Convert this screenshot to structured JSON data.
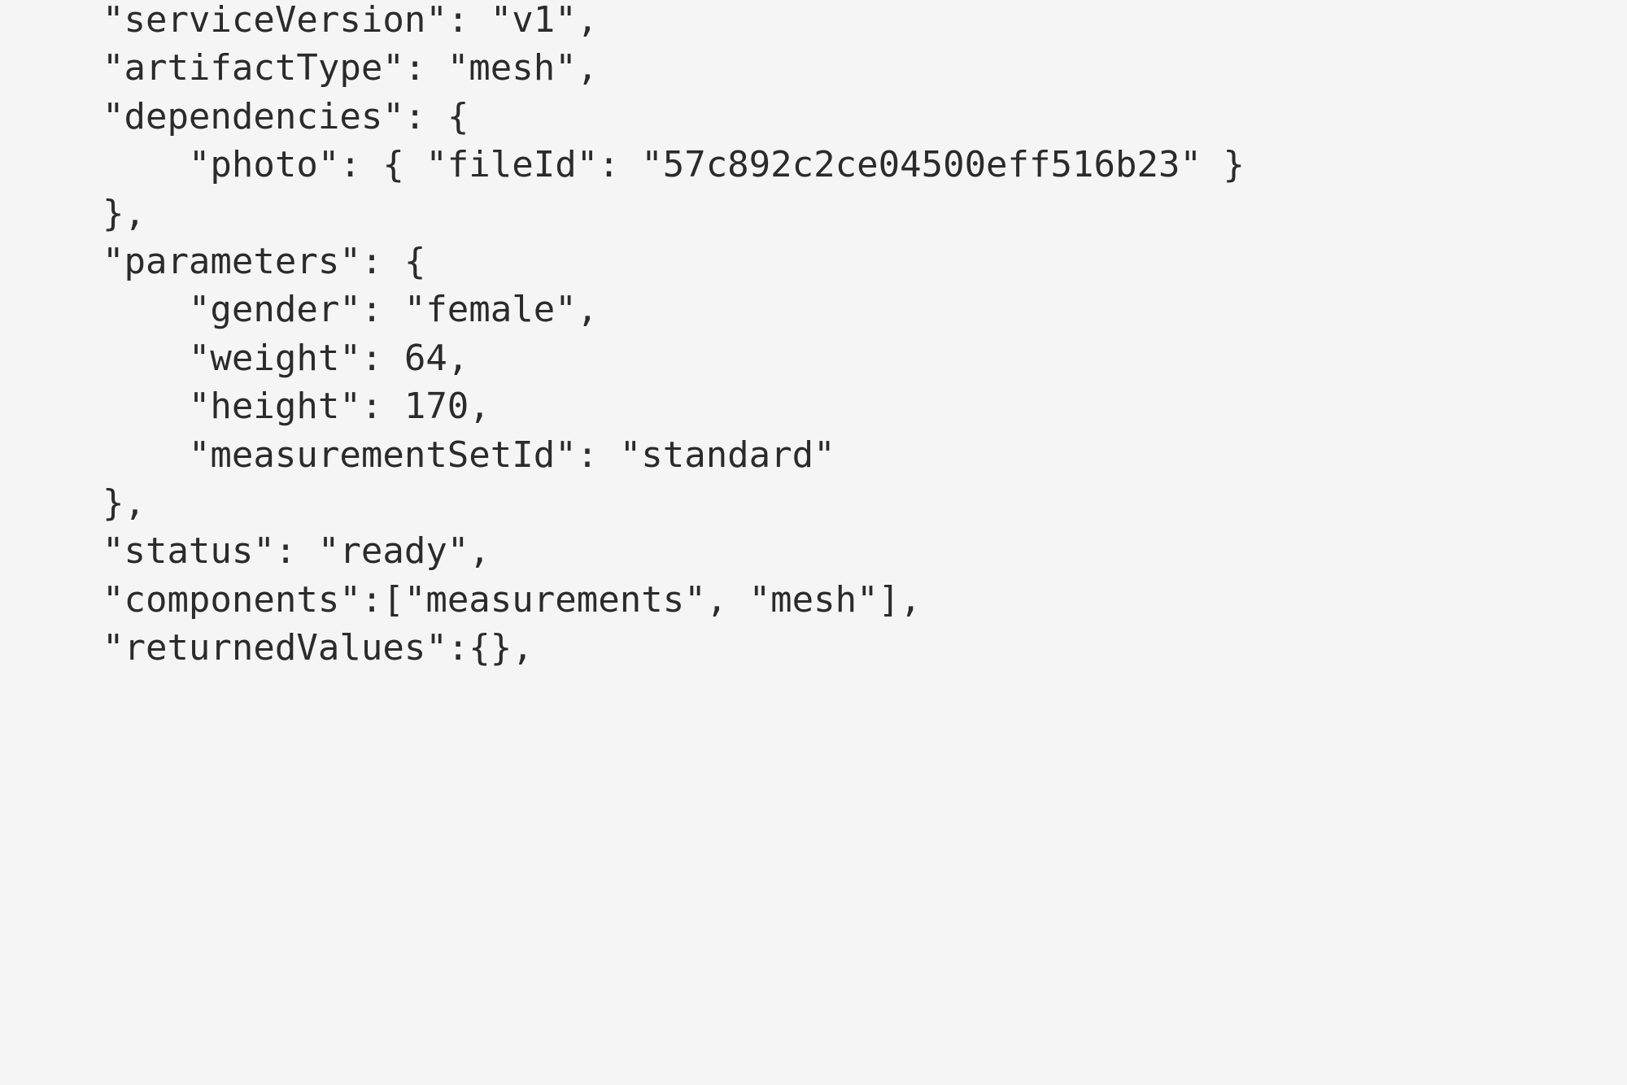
{
  "code": {
    "line1": "    \"serviceVersion\": \"v1\",",
    "line2": "    \"artifactType\": \"mesh\",",
    "line3": "    \"dependencies\": {",
    "line4": "        \"photo\": { \"fileId\": \"57c892c2ce04500eff516b23\" }",
    "line5": "    },",
    "line6": "    \"parameters\": {",
    "line7": "        \"gender\": \"female\",",
    "line8": "        \"weight\": 64,",
    "line9": "        \"height\": 170,",
    "line10": "        \"measurementSetId\": \"standard\"",
    "line11": "    },",
    "line12": "    \"status\": \"ready\",",
    "line13": "    \"components\":[\"measurements\", \"mesh\"],",
    "line14": "    \"returnedValues\":{},"
  },
  "jsonPayload": {
    "serviceVersion": "v1",
    "artifactType": "mesh",
    "dependencies": {
      "photo": {
        "fileId": "57c892c2ce04500eff516b23"
      }
    },
    "parameters": {
      "gender": "female",
      "weight": 64,
      "height": 170,
      "measurementSetId": "standard"
    },
    "status": "ready",
    "components": [
      "measurements",
      "mesh"
    ],
    "returnedValues": {}
  }
}
